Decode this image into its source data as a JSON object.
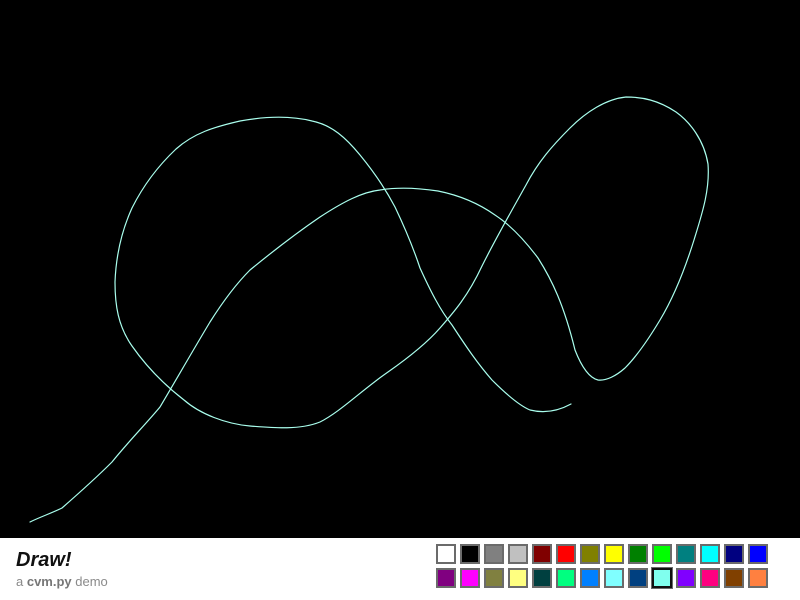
{
  "canvas": {
    "background": "#000000",
    "stroke_color": "#aaffee"
  },
  "toolbar": {
    "title": "Draw!",
    "subtitle": {
      "prefix": "a ",
      "name": "cvm.py",
      "suffix": " demo"
    }
  },
  "palette": {
    "selected_index": 23,
    "colors": [
      "#ffffff",
      "#000000",
      "#808080",
      "#c0c0c0",
      "#800000",
      "#ff0000",
      "#808000",
      "#ffff00",
      "#008000",
      "#00ff00",
      "#008080",
      "#00ffff",
      "#000080",
      "#0000ff",
      "#800080",
      "#ff00ff",
      "#808040",
      "#ffff80",
      "#004040",
      "#00ff80",
      "#0080ff",
      "#80ffff",
      "#004080",
      "#80ffee",
      "#8000ff",
      "#ff0080",
      "#804000",
      "#ff8040"
    ]
  }
}
